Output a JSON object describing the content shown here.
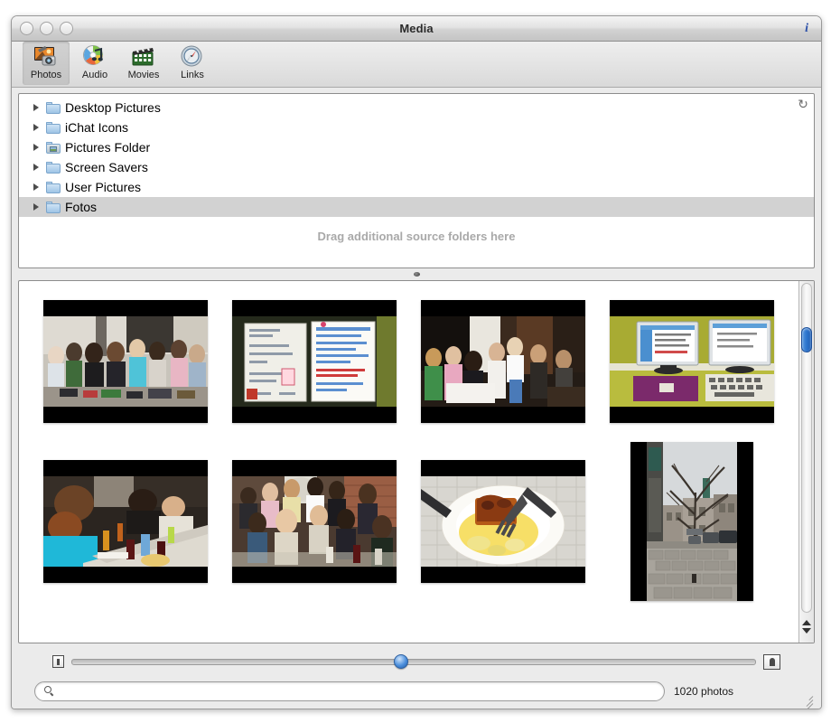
{
  "window": {
    "title": "Media",
    "info_icon": "i",
    "close_button": "close-button",
    "minimize_button": "minimize-button",
    "zoom_button": "zoom-button"
  },
  "toolbar": {
    "items": [
      {
        "label": "Photos",
        "icon": "photos-icon",
        "selected": true
      },
      {
        "label": "Audio",
        "icon": "audio-icon",
        "selected": false
      },
      {
        "label": "Movies",
        "icon": "movies-icon",
        "selected": false
      },
      {
        "label": "Links",
        "icon": "links-icon",
        "selected": false
      }
    ]
  },
  "source_list": {
    "refresh_icon": "↻",
    "drag_hint": "Drag additional source folders here",
    "items": [
      {
        "label": "Desktop Pictures",
        "icon": "folder-icon",
        "selected": false
      },
      {
        "label": "iChat Icons",
        "icon": "folder-icon",
        "selected": false
      },
      {
        "label": "Pictures Folder",
        "icon": "pictures-folder-icon",
        "selected": false
      },
      {
        "label": "Screen Savers",
        "icon": "folder-icon",
        "selected": false
      },
      {
        "label": "User Pictures",
        "icon": "folder-icon",
        "selected": false
      },
      {
        "label": "Fotos",
        "icon": "folder-icon",
        "selected": true
      }
    ]
  },
  "browser": {
    "thumbnails": [
      {
        "name": "crowd-indoor-market",
        "orientation": "landscape"
      },
      {
        "name": "documents-on-dark",
        "orientation": "landscape"
      },
      {
        "name": "classroom-meeting",
        "orientation": "landscape"
      },
      {
        "name": "computer-lab-monitors",
        "orientation": "landscape"
      },
      {
        "name": "dinner-table-people",
        "orientation": "landscape"
      },
      {
        "name": "party-brick-room",
        "orientation": "landscape"
      },
      {
        "name": "food-plate-dessert",
        "orientation": "landscape"
      },
      {
        "name": "street-tree-winter",
        "orientation": "portrait"
      }
    ],
    "scrollbar": {
      "up_arrow": "scroll-up-arrow",
      "down_arrow": "scroll-down-arrow"
    }
  },
  "bottom_bar": {
    "size_slider": {
      "small_icon": "small-thumbnail-icon",
      "large_icon": "large-thumbnail-icon",
      "value_percent": 48
    },
    "search": {
      "value": "",
      "placeholder": "",
      "icon": "search-icon"
    },
    "photo_count": "1020 photos"
  },
  "colors": {
    "selection": "#d2d2d2",
    "accent_blue": "#2f77cf",
    "hint_gray": "#a9a9a9",
    "title_text": "#2b2b2b"
  }
}
